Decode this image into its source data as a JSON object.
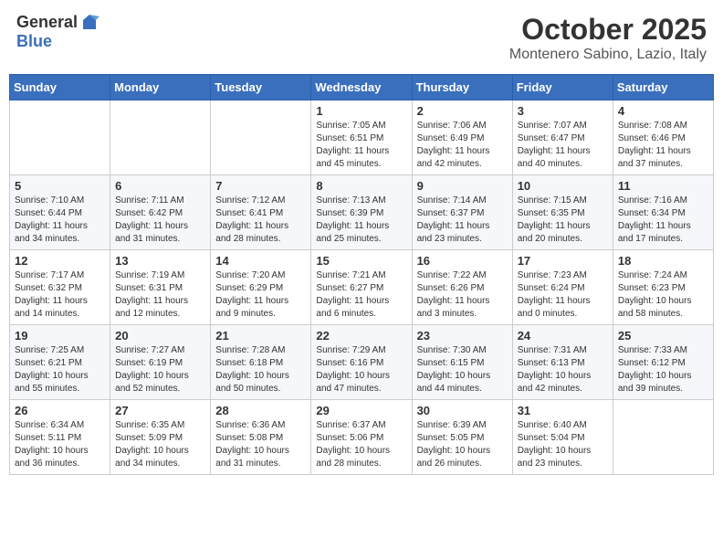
{
  "header": {
    "logo_general": "General",
    "logo_blue": "Blue",
    "month_title": "October 2025",
    "location": "Montenero Sabino, Lazio, Italy"
  },
  "weekdays": [
    "Sunday",
    "Monday",
    "Tuesday",
    "Wednesday",
    "Thursday",
    "Friday",
    "Saturday"
  ],
  "weeks": [
    [
      {
        "day": "",
        "info": ""
      },
      {
        "day": "",
        "info": ""
      },
      {
        "day": "",
        "info": ""
      },
      {
        "day": "1",
        "info": "Sunrise: 7:05 AM\nSunset: 6:51 PM\nDaylight: 11 hours and 45 minutes."
      },
      {
        "day": "2",
        "info": "Sunrise: 7:06 AM\nSunset: 6:49 PM\nDaylight: 11 hours and 42 minutes."
      },
      {
        "day": "3",
        "info": "Sunrise: 7:07 AM\nSunset: 6:47 PM\nDaylight: 11 hours and 40 minutes."
      },
      {
        "day": "4",
        "info": "Sunrise: 7:08 AM\nSunset: 6:46 PM\nDaylight: 11 hours and 37 minutes."
      }
    ],
    [
      {
        "day": "5",
        "info": "Sunrise: 7:10 AM\nSunset: 6:44 PM\nDaylight: 11 hours and 34 minutes."
      },
      {
        "day": "6",
        "info": "Sunrise: 7:11 AM\nSunset: 6:42 PM\nDaylight: 11 hours and 31 minutes."
      },
      {
        "day": "7",
        "info": "Sunrise: 7:12 AM\nSunset: 6:41 PM\nDaylight: 11 hours and 28 minutes."
      },
      {
        "day": "8",
        "info": "Sunrise: 7:13 AM\nSunset: 6:39 PM\nDaylight: 11 hours and 25 minutes."
      },
      {
        "day": "9",
        "info": "Sunrise: 7:14 AM\nSunset: 6:37 PM\nDaylight: 11 hours and 23 minutes."
      },
      {
        "day": "10",
        "info": "Sunrise: 7:15 AM\nSunset: 6:35 PM\nDaylight: 11 hours and 20 minutes."
      },
      {
        "day": "11",
        "info": "Sunrise: 7:16 AM\nSunset: 6:34 PM\nDaylight: 11 hours and 17 minutes."
      }
    ],
    [
      {
        "day": "12",
        "info": "Sunrise: 7:17 AM\nSunset: 6:32 PM\nDaylight: 11 hours and 14 minutes."
      },
      {
        "day": "13",
        "info": "Sunrise: 7:19 AM\nSunset: 6:31 PM\nDaylight: 11 hours and 12 minutes."
      },
      {
        "day": "14",
        "info": "Sunrise: 7:20 AM\nSunset: 6:29 PM\nDaylight: 11 hours and 9 minutes."
      },
      {
        "day": "15",
        "info": "Sunrise: 7:21 AM\nSunset: 6:27 PM\nDaylight: 11 hours and 6 minutes."
      },
      {
        "day": "16",
        "info": "Sunrise: 7:22 AM\nSunset: 6:26 PM\nDaylight: 11 hours and 3 minutes."
      },
      {
        "day": "17",
        "info": "Sunrise: 7:23 AM\nSunset: 6:24 PM\nDaylight: 11 hours and 0 minutes."
      },
      {
        "day": "18",
        "info": "Sunrise: 7:24 AM\nSunset: 6:23 PM\nDaylight: 10 hours and 58 minutes."
      }
    ],
    [
      {
        "day": "19",
        "info": "Sunrise: 7:25 AM\nSunset: 6:21 PM\nDaylight: 10 hours and 55 minutes."
      },
      {
        "day": "20",
        "info": "Sunrise: 7:27 AM\nSunset: 6:19 PM\nDaylight: 10 hours and 52 minutes."
      },
      {
        "day": "21",
        "info": "Sunrise: 7:28 AM\nSunset: 6:18 PM\nDaylight: 10 hours and 50 minutes."
      },
      {
        "day": "22",
        "info": "Sunrise: 7:29 AM\nSunset: 6:16 PM\nDaylight: 10 hours and 47 minutes."
      },
      {
        "day": "23",
        "info": "Sunrise: 7:30 AM\nSunset: 6:15 PM\nDaylight: 10 hours and 44 minutes."
      },
      {
        "day": "24",
        "info": "Sunrise: 7:31 AM\nSunset: 6:13 PM\nDaylight: 10 hours and 42 minutes."
      },
      {
        "day": "25",
        "info": "Sunrise: 7:33 AM\nSunset: 6:12 PM\nDaylight: 10 hours and 39 minutes."
      }
    ],
    [
      {
        "day": "26",
        "info": "Sunrise: 6:34 AM\nSunset: 5:11 PM\nDaylight: 10 hours and 36 minutes."
      },
      {
        "day": "27",
        "info": "Sunrise: 6:35 AM\nSunset: 5:09 PM\nDaylight: 10 hours and 34 minutes."
      },
      {
        "day": "28",
        "info": "Sunrise: 6:36 AM\nSunset: 5:08 PM\nDaylight: 10 hours and 31 minutes."
      },
      {
        "day": "29",
        "info": "Sunrise: 6:37 AM\nSunset: 5:06 PM\nDaylight: 10 hours and 28 minutes."
      },
      {
        "day": "30",
        "info": "Sunrise: 6:39 AM\nSunset: 5:05 PM\nDaylight: 10 hours and 26 minutes."
      },
      {
        "day": "31",
        "info": "Sunrise: 6:40 AM\nSunset: 5:04 PM\nDaylight: 10 hours and 23 minutes."
      },
      {
        "day": "",
        "info": ""
      }
    ]
  ]
}
